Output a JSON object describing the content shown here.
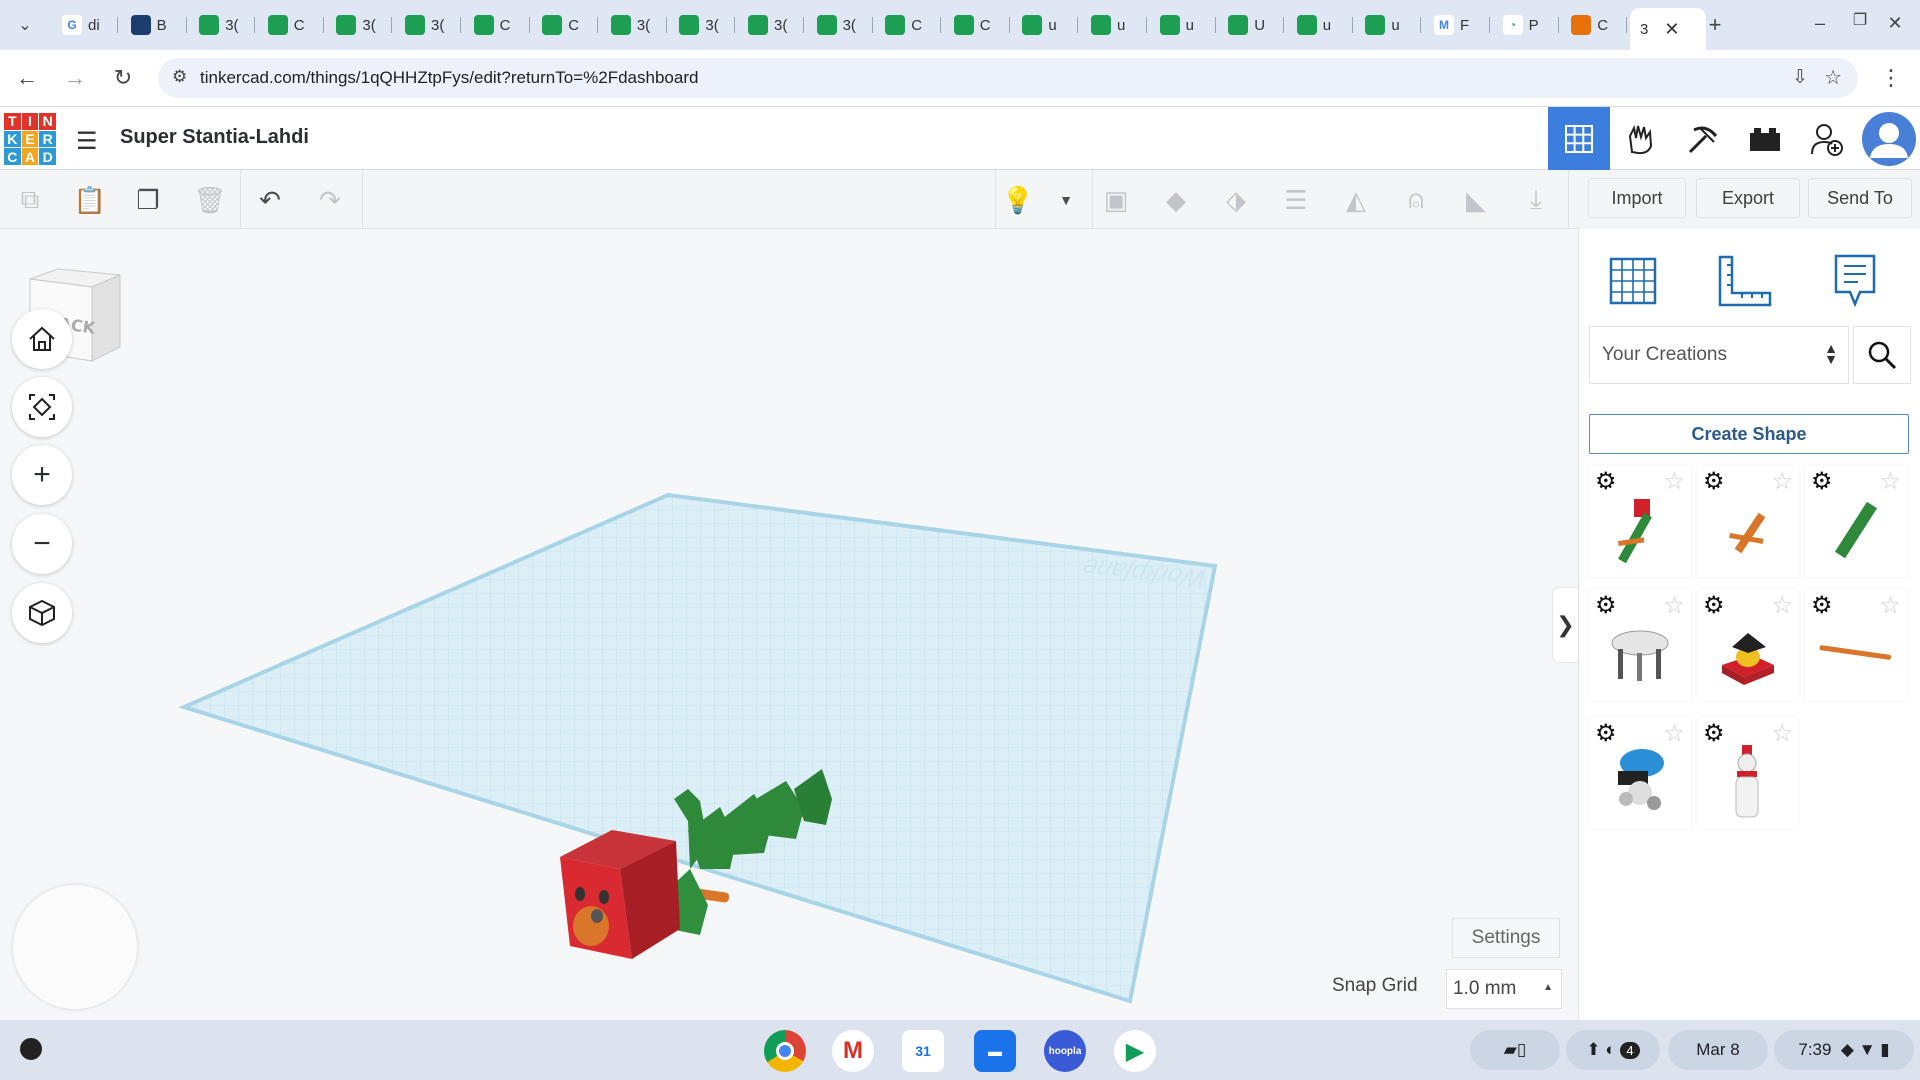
{
  "browser": {
    "tabs": [
      {
        "fav_color": "#ffffff",
        "fav_text": "G",
        "label": "di"
      },
      {
        "fav_color": "#1c3d6e",
        "fav_text": "",
        "label": "B"
      },
      {
        "fav_color": "#1e9e52",
        "fav_text": "",
        "label": "3("
      },
      {
        "fav_color": "#1e9e52",
        "fav_text": "",
        "label": "C"
      },
      {
        "fav_color": "#1e9e52",
        "fav_text": "",
        "label": "3("
      },
      {
        "fav_color": "#1e9e52",
        "fav_text": "",
        "label": "3("
      },
      {
        "fav_color": "#1e9e52",
        "fav_text": "",
        "label": "C"
      },
      {
        "fav_color": "#1e9e52",
        "fav_text": "",
        "label": "C"
      },
      {
        "fav_color": "#1e9e52",
        "fav_text": "",
        "label": "3("
      },
      {
        "fav_color": "#1e9e52",
        "fav_text": "",
        "label": "3("
      },
      {
        "fav_color": "#1e9e52",
        "fav_text": "",
        "label": "3("
      },
      {
        "fav_color": "#1e9e52",
        "fav_text": "",
        "label": "3("
      },
      {
        "fav_color": "#1e9e52",
        "fav_text": "",
        "label": "C"
      },
      {
        "fav_color": "#1e9e52",
        "fav_text": "",
        "label": "C"
      },
      {
        "fav_color": "#1e9e52",
        "fav_text": "",
        "label": "u"
      },
      {
        "fav_color": "#1e9e52",
        "fav_text": "",
        "label": "u"
      },
      {
        "fav_color": "#1e9e52",
        "fav_text": "",
        "label": "u"
      },
      {
        "fav_color": "#1e9e52",
        "fav_text": "",
        "label": "U"
      },
      {
        "fav_color": "#1e9e52",
        "fav_text": "",
        "label": "u"
      },
      {
        "fav_color": "#1e9e52",
        "fav_text": "",
        "label": "u"
      },
      {
        "fav_color": "#ffffff",
        "fav_text": "M",
        "label": "F"
      },
      {
        "fav_color": "#ffffff",
        "fav_text": "◔",
        "label": "P"
      },
      {
        "fav_color": "#e8710a",
        "fav_text": "",
        "label": "C"
      }
    ],
    "active_tab_label": "3",
    "url": "tinkercad.com/things/1qQHHZtpFys/edit?returnTo=%2Fdashboard"
  },
  "header": {
    "project_name": "Super Stantia-Lahdi",
    "logo_letters": [
      "T",
      "I",
      "N",
      "K",
      "E",
      "R",
      "C",
      "A",
      "D"
    ]
  },
  "toolbar": {
    "import_label": "Import",
    "export_label": "Export",
    "sendto_label": "Send To"
  },
  "viewcube": {
    "face_label": "BACK"
  },
  "workplane": {
    "label": "Workplane"
  },
  "canvas": {
    "settings_label": "Settings",
    "snap_grid_label": "Snap Grid",
    "snap_grid_value": "1.0 mm"
  },
  "sidebar": {
    "library_select": "Your Creations",
    "create_shape_label": "Create Shape"
  },
  "shelf": {
    "date": "Mar 8",
    "time": "7:39",
    "notification_count": "4"
  },
  "colors": {
    "accent_blue": "#3b7ede",
    "shape_red": "#d0202a",
    "shape_green": "#2e8a3a",
    "shape_orange": "#d9762a",
    "workplane": "#dbeef6"
  }
}
